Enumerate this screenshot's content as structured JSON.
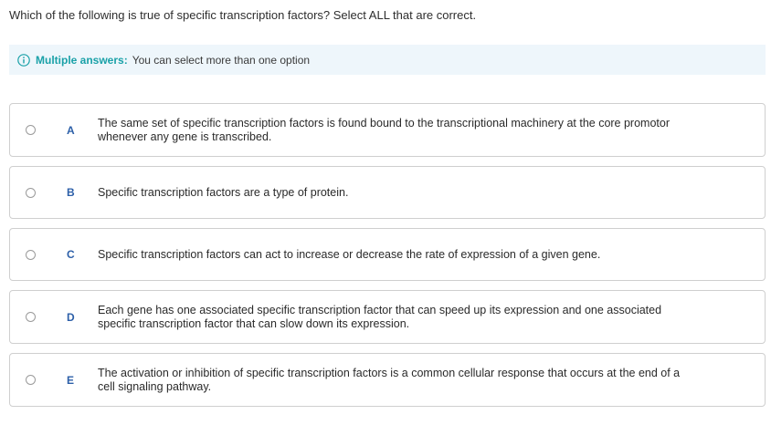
{
  "question": "Which of the following is true of specific transcription factors? Select ALL that are correct.",
  "info": {
    "label": "Multiple answers:",
    "text": "You can select more than one option",
    "icon": "info-icon",
    "accent_color": "#1aa1a8"
  },
  "options": [
    {
      "letter": "A",
      "line1": "The same set of specific transcription factors is found bound to the transcriptional machinery at the core promotor",
      "line2": "whenever any gene is transcribed."
    },
    {
      "letter": "B",
      "line1": "Specific transcription factors are a type of protein.",
      "line2": ""
    },
    {
      "letter": "C",
      "line1": "Specific transcription factors can act to increase or decrease the rate of expression of a given gene.",
      "line2": ""
    },
    {
      "letter": "D",
      "line1": "Each gene has one associated specific transcription factor that can speed up its expression and one associated",
      "line2": "specific transcription factor that can slow down its expression."
    },
    {
      "letter": "E",
      "line1": "The activation or inhibition of specific transcription factors is a common cellular response that occurs at the end of a",
      "line2": "cell signaling pathway."
    }
  ]
}
